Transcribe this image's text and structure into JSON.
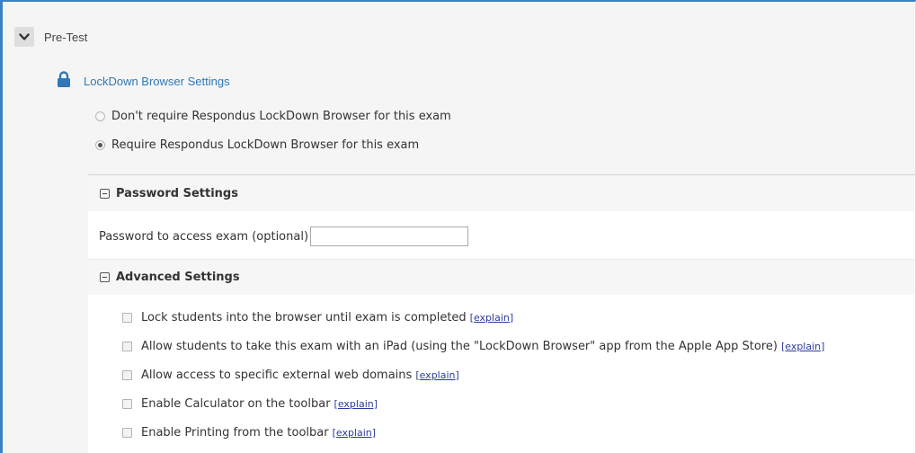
{
  "exam": {
    "title": "Pre-Test"
  },
  "ldb": {
    "title": "LockDown Browser Settings"
  },
  "require_options": [
    {
      "label": "Don't require Respondus LockDown Browser for this exam",
      "selected": false
    },
    {
      "label": "Require Respondus LockDown Browser for this exam",
      "selected": true
    }
  ],
  "password_section": {
    "title": "Password Settings",
    "field_label": "Password to access exam (optional)",
    "field_value": ""
  },
  "advanced_section": {
    "title": "Advanced Settings",
    "explain_label": "[explain]",
    "options": [
      {
        "label": "Lock students into the browser until exam is completed",
        "checked": false
      },
      {
        "label": "Allow students to take this exam with an iPad (using the \"LockDown Browser\" app from the Apple App Store)",
        "checked": false
      },
      {
        "label": "Allow access to specific external web domains",
        "checked": false
      },
      {
        "label": "Enable Calculator on the toolbar",
        "checked": false
      },
      {
        "label": "Enable Printing from the toolbar",
        "checked": false
      }
    ]
  },
  "colors": {
    "accent": "#2f78b5",
    "link": "#2b3a9b",
    "frame": "#3b82c4"
  },
  "icons": {
    "collapse": "chevron-down-icon",
    "lock": "lock-icon",
    "section_toggle": "collapse-minus-icon"
  }
}
